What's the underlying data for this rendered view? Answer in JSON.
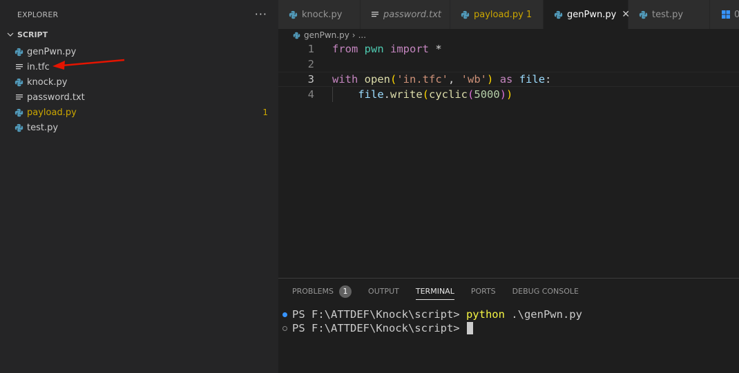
{
  "explorer": {
    "title": "EXPLORER",
    "more": "···",
    "folder": "SCRIPT",
    "files": [
      {
        "name": "genPwn.py",
        "icon": "python-icon"
      },
      {
        "name": "in.tfc",
        "icon": "text-file-icon"
      },
      {
        "name": "knock.py",
        "icon": "python-icon"
      },
      {
        "name": "password.txt",
        "icon": "text-file-icon"
      },
      {
        "name": "payload.py",
        "icon": "python-icon",
        "badge": "1",
        "warning": true
      },
      {
        "name": "test.py",
        "icon": "python-icon"
      }
    ]
  },
  "tabs": [
    {
      "label": "knock.py",
      "icon": "python-icon"
    },
    {
      "label": "password.txt",
      "icon": "text-file-icon",
      "italic": true
    },
    {
      "label": "payload.py 1",
      "icon": "python-icon",
      "warning": true
    },
    {
      "label": "genPwn.py",
      "icon": "python-icon",
      "active": true,
      "close": "✕"
    },
    {
      "label": "test.py",
      "icon": "python-icon"
    },
    {
      "label": "0",
      "icon": "windows-icon"
    }
  ],
  "breadcrumb": {
    "file": "genPwn.py",
    "sep": "›",
    "more": "..."
  },
  "editor": {
    "line_numbers": [
      "1",
      "2",
      "3",
      "4"
    ],
    "l1": {
      "from": "from",
      "mod": "pwn",
      "import": "import",
      "star": "*"
    },
    "l3": {
      "with": "with",
      "open": "open",
      "p1": "(",
      "s1": "'in.tfc'",
      "comma": ", ",
      "s2": "'wb'",
      "p2": ")",
      "as": "as",
      "file": "file",
      "colon": ":"
    },
    "l4": {
      "file": "file",
      "dot": ".",
      "write": "write",
      "p1": "(",
      "cyclic": "cyclic",
      "p2": "(",
      "num": "5000",
      "p3": ")",
      "p4": ")"
    }
  },
  "panel": {
    "tabs": [
      "PROBLEMS",
      "OUTPUT",
      "TERMINAL",
      "PORTS",
      "DEBUG CONSOLE"
    ],
    "problems_badge": "1",
    "terminal": {
      "prompt": "PS F:\\ATTDEF\\Knock\\script> ",
      "command": "python",
      "args": " .\\genPwn.py",
      "prompt2": "PS F:\\ATTDEF\\Knock\\script> "
    }
  },
  "colors": {
    "accent": "#3794ff",
    "warning": "#cca700",
    "arrow": "#e51400"
  }
}
